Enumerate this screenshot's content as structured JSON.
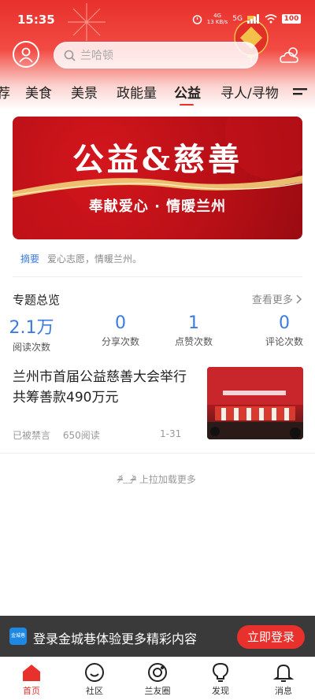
{
  "status_bar": {
    "time": "15:35",
    "network_type": "4G",
    "network_speed": "13 KB/s",
    "signal": "5G",
    "battery": "100"
  },
  "header": {
    "search": {
      "placeholder": "兰哈顿"
    }
  },
  "tabs": [
    {
      "label": "荐"
    },
    {
      "label": "美食"
    },
    {
      "label": "美景"
    },
    {
      "label": "政能量"
    },
    {
      "label": "公益",
      "active": true
    },
    {
      "label": "寻人/寻物"
    }
  ],
  "banner": {
    "title": "公益&慈善",
    "subtitle": "奉献爱心 · 情暖兰州"
  },
  "summary": {
    "label": "摘要",
    "text": "爱心志愿，情暖兰州。"
  },
  "overview": {
    "title": "专题总览",
    "more": "查看更多",
    "stats": [
      {
        "value": "2.1万",
        "label": "阅读次数"
      },
      {
        "value": "0",
        "label": "分享次数"
      },
      {
        "value": "1",
        "label": "点赞次数"
      },
      {
        "value": "0",
        "label": "评论次数"
      }
    ]
  },
  "article": {
    "title": "兰州市首届公益慈善大会举行 共筹善款490万元",
    "status": "已被禁言",
    "reads": "650阅读",
    "date": "1-31"
  },
  "load_more": "ᵒ̴̶̷᷄﹏ᵒ̴̶̷᷅ 上拉加载更多",
  "login_bar": {
    "logo_text": "金城巷",
    "message": "登录金城巷体验更多精彩内容",
    "button": "立即登录"
  },
  "bottom_nav": [
    {
      "label": "首页",
      "icon": "home-icon",
      "active": true
    },
    {
      "label": "社区",
      "icon": "smile-icon"
    },
    {
      "label": "兰友圈",
      "icon": "circle-icon"
    },
    {
      "label": "发现",
      "icon": "bulb-icon"
    },
    {
      "label": "消息",
      "icon": "bell-icon"
    }
  ],
  "colors": {
    "accent": "#e8302c",
    "link_blue": "#3b7be0",
    "login_bar_bg": "#3a3a3a"
  }
}
